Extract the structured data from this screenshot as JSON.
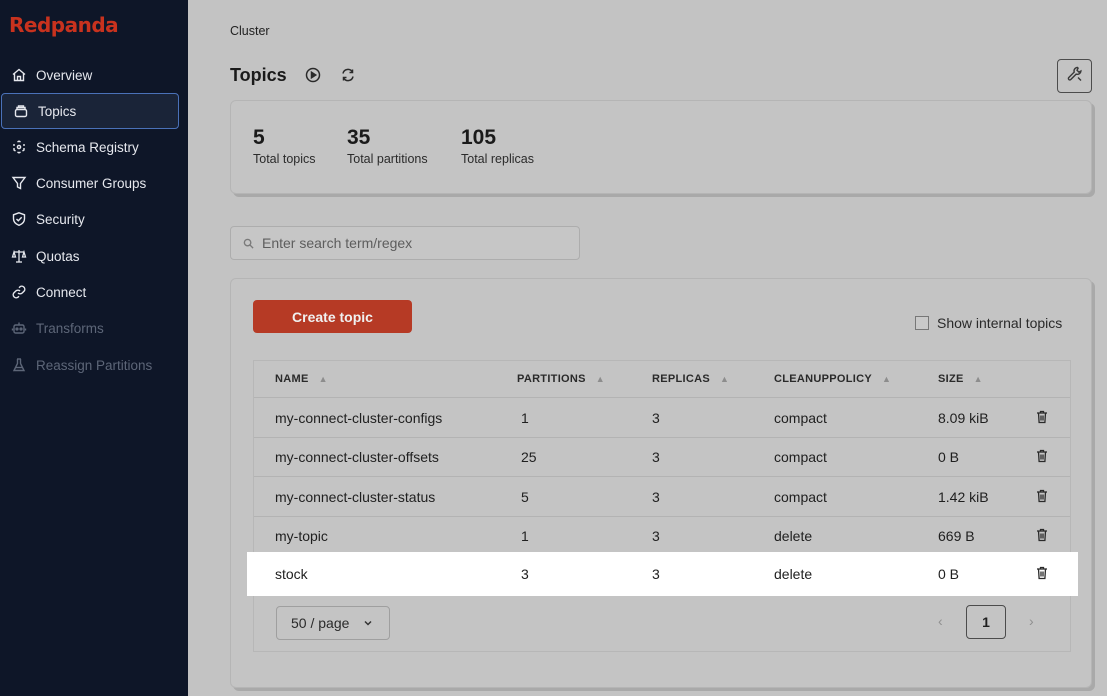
{
  "brand": {
    "name": "Redpanda",
    "color": "#c8321e"
  },
  "sidebar": {
    "items": [
      {
        "label": "Overview",
        "icon": "home-icon",
        "state": "normal"
      },
      {
        "label": "Topics",
        "icon": "collection-icon",
        "state": "active"
      },
      {
        "label": "Schema Registry",
        "icon": "cube-icon",
        "state": "normal"
      },
      {
        "label": "Consumer Groups",
        "icon": "filter-icon",
        "state": "normal"
      },
      {
        "label": "Security",
        "icon": "shield-check-icon",
        "state": "normal"
      },
      {
        "label": "Quotas",
        "icon": "scale-icon",
        "state": "normal"
      },
      {
        "label": "Connect",
        "icon": "link-icon",
        "state": "normal"
      },
      {
        "label": "Transforms",
        "icon": "robot-icon",
        "state": "disabled"
      },
      {
        "label": "Reassign Partitions",
        "icon": "beaker-icon",
        "state": "disabled"
      }
    ]
  },
  "breadcrumb": "Cluster",
  "page": {
    "title": "Topics"
  },
  "stats": [
    {
      "value": "5",
      "label": "Total topics"
    },
    {
      "value": "35",
      "label": "Total partitions"
    },
    {
      "value": "105",
      "label": "Total replicas"
    }
  ],
  "search": {
    "placeholder": "Enter search term/regex",
    "value": ""
  },
  "actions": {
    "create_topic": "Create topic",
    "show_internal": "Show internal topics",
    "show_internal_checked": false
  },
  "table": {
    "columns": [
      "NAME",
      "PARTITIONS",
      "REPLICAS",
      "CLEANUPPOLICY",
      "SIZE"
    ],
    "rows": [
      {
        "name": "my-connect-cluster-configs",
        "partitions": "1",
        "replicas": "3",
        "cleanup": "compact",
        "size": "8.09 kiB"
      },
      {
        "name": "my-connect-cluster-offsets",
        "partitions": "25",
        "replicas": "3",
        "cleanup": "compact",
        "size": "0 B"
      },
      {
        "name": "my-connect-cluster-status",
        "partitions": "5",
        "replicas": "3",
        "cleanup": "compact",
        "size": "1.42 kiB"
      },
      {
        "name": "my-topic",
        "partitions": "1",
        "replicas": "3",
        "cleanup": "delete",
        "size": "669 B"
      },
      {
        "name": "stock",
        "partitions": "3",
        "replicas": "3",
        "cleanup": "delete",
        "size": "0 B"
      }
    ]
  },
  "pagination": {
    "page_size": "50 / page",
    "current_page": "1",
    "prev": "‹",
    "next": "›"
  }
}
